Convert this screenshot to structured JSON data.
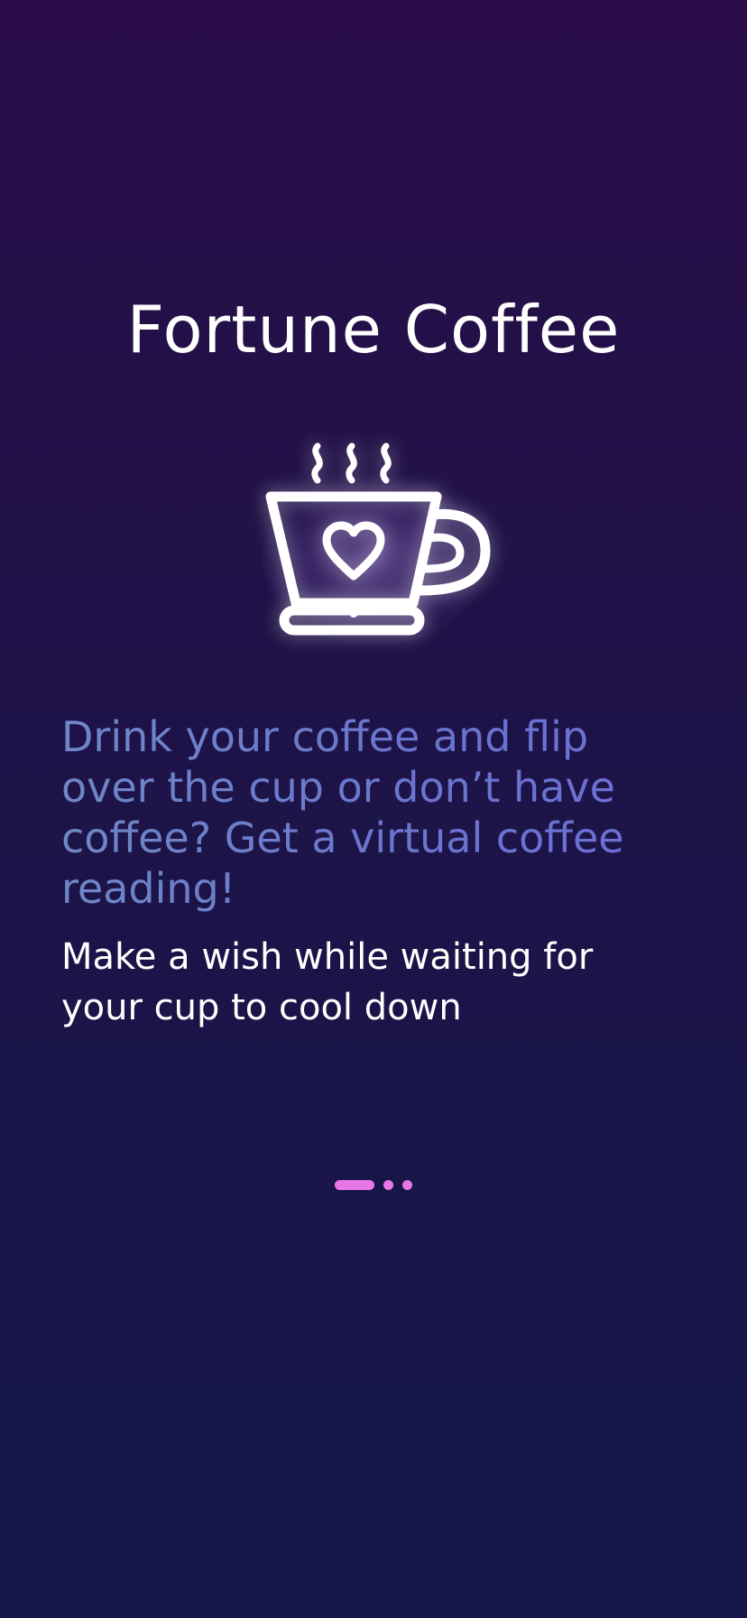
{
  "app": {
    "title": "Fortune Coffee"
  },
  "hero": {
    "icon": "coffee-cup-heart-icon"
  },
  "onboarding": {
    "headline": "Drink your coffee and flip over the cup or don’t have coffee? Get a virtual coffee reading!",
    "subtext": "Make a wish while waiting for your cup to cool down",
    "page_indicator": {
      "total": 3,
      "current": 1
    }
  },
  "colors": {
    "background_top": "#2a0d4a",
    "background_bottom": "#15174a",
    "headline": "#6a74cf",
    "indicator": "#e877e6",
    "text": "#ffffff"
  }
}
